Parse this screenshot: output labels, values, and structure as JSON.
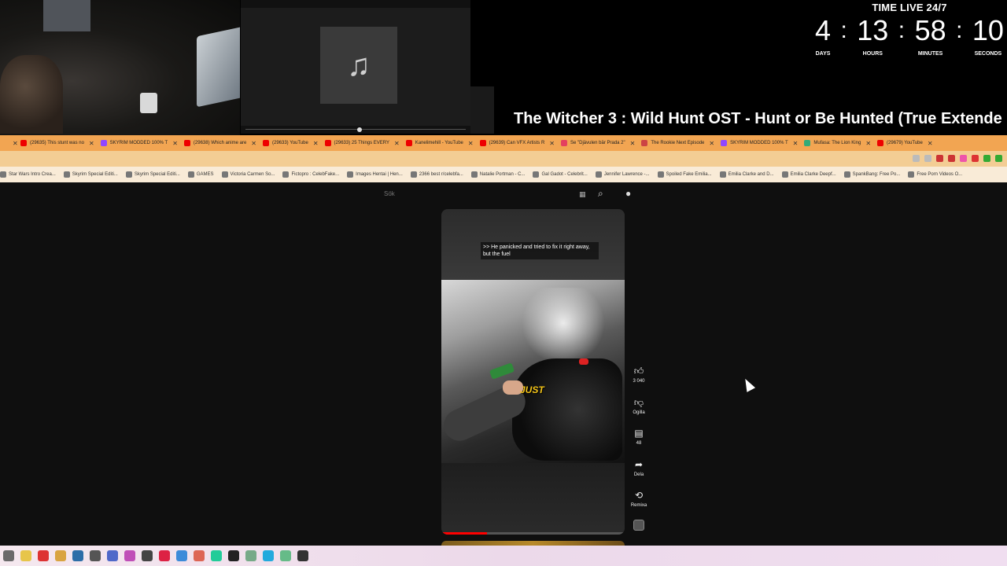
{
  "overlay": {
    "timer_label": "TIME LIVE 24/7",
    "timer": [
      {
        "value": "4",
        "caption": "DAYS"
      },
      {
        "value": "13",
        "caption": "HOURS"
      },
      {
        "value": "58",
        "caption": "MINUTES"
      },
      {
        "value": "10",
        "caption": "SECONDS"
      }
    ],
    "now_playing": "The Witcher 3 :  Wild Hunt OST - Hunt or Be Hunted (True Extende",
    "album_art_icon": "music-note-icon",
    "separator": ":"
  },
  "tabs": [
    {
      "label": "(29635) This stunt was no",
      "favicon": "#e00"
    },
    {
      "label": "SKYRIM MODDED 100% T",
      "favicon": "#9146ff"
    },
    {
      "label": "(29638) Which anime are",
      "favicon": "#e00"
    },
    {
      "label": "(29633) YouTube",
      "favicon": "#e00"
    },
    {
      "label": "(29633) 25 Things EVERY",
      "favicon": "#e00"
    },
    {
      "label": "Kanelimehill - YouTube",
      "favicon": "#e00"
    },
    {
      "label": "(29639) Can VFX Artists R",
      "favicon": "#e00"
    },
    {
      "label": "Se \"Djävulen bär Prada 2\"",
      "favicon": "#e4405f"
    },
    {
      "label": "The Rookie Next Episode",
      "favicon": "#c44"
    },
    {
      "label": "SKYRIM MODDED 100% T",
      "favicon": "#9146ff"
    },
    {
      "label": "Mufasa: The Lion King",
      "favicon": "#3a7"
    },
    {
      "label": "(29679) YouTube",
      "favicon": "#e00"
    }
  ],
  "bookmarks": [
    "Star Wars Intro Crea...",
    "Skyrim Special Editi...",
    "Skyrim Special Editi...",
    "GAMES",
    "Victoria Carmen So...",
    "Fictopro : CelebFake...",
    "Images Hentai | Hen...",
    "2366 best r/celebfa...",
    "Natalie Portman - C...",
    "Gal Gadot - Celebrit...",
    "Jennifer Lawrence -...",
    "Spoiled Fake Emilia...",
    "Emilia Clarke and D...",
    "Emilia Clarke Deepf...",
    "SpankBang: Free Po...",
    "Free Porn Videos O..."
  ],
  "search": {
    "placeholder": "Sök"
  },
  "short": {
    "caption": ">> He panicked and tried to fix it right away, but the fuel",
    "overlay_word": "JUST",
    "progress_fraction": 0.25
  },
  "actions": [
    {
      "name": "like",
      "icon": "thumbs-up-icon",
      "label": "3 040"
    },
    {
      "name": "dislike",
      "icon": "thumbs-down-icon",
      "label": "Ogilla"
    },
    {
      "name": "comments",
      "icon": "comment-icon",
      "label": "48"
    },
    {
      "name": "share",
      "icon": "share-icon",
      "label": "Dela"
    },
    {
      "name": "remix",
      "icon": "remix-icon",
      "label": "Remixa"
    }
  ],
  "taskbar_colors": [
    "#6a6a6a",
    "#e7c54a",
    "#d33",
    "#d9a441",
    "#2d6ea8",
    "#555",
    "#4f68c9",
    "#c04fb8",
    "#444",
    "#d24",
    "#3d8bd9",
    "#d65",
    "#2c9",
    "#222",
    "#7a8",
    "#2ad",
    "#6b8",
    "#333"
  ]
}
